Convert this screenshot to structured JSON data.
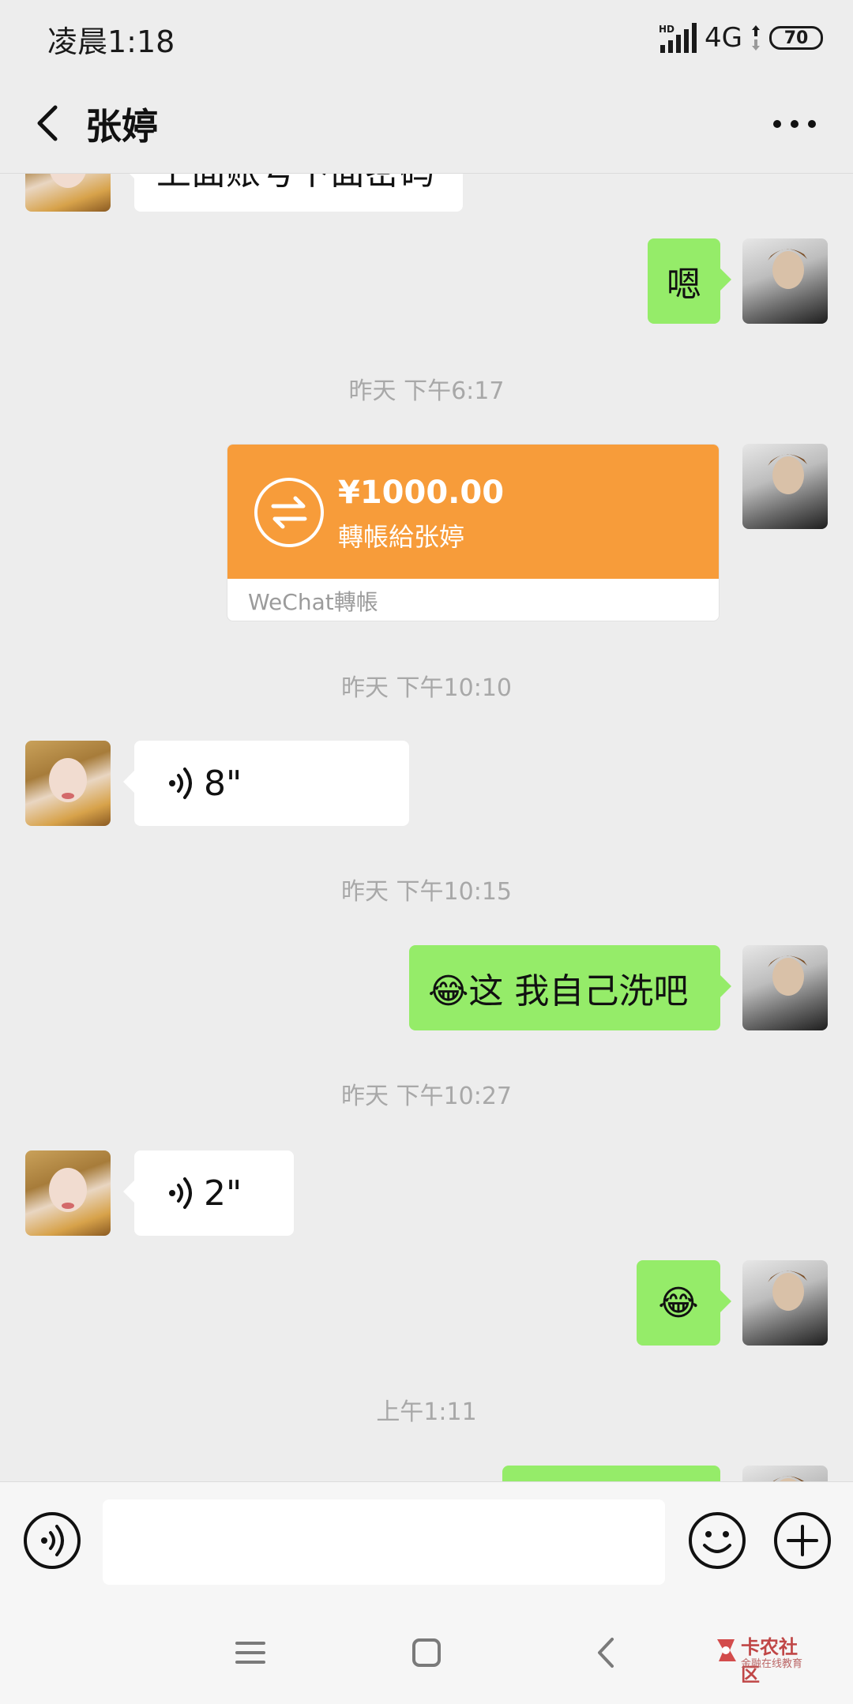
{
  "status_bar": {
    "time": "凌晨1:18",
    "network": "4G",
    "battery": "70"
  },
  "header": {
    "title": "张婷"
  },
  "messages": {
    "partial_top_text": "上面账号下面密码",
    "reply_1": "嗯",
    "ts_1": "昨天 下午6:17",
    "transfer": {
      "amount": "¥1000.00",
      "description": "轉帳給张婷",
      "footer": "WeChat轉帳"
    },
    "ts_2": "昨天 下午10:10",
    "voice_1": "8\"",
    "ts_3": "昨天 下午10:15",
    "reply_2": "😂这 我自己洗吧",
    "ts_4": "昨天 下午10:27",
    "voice_2": "2\"",
    "reply_3": "😂",
    "ts_5": "上午1:11"
  },
  "watermark": {
    "title": "卡农社区",
    "subtitle": "金融在线教育"
  },
  "colors": {
    "bubble_self": "#95ec69",
    "bubble_other": "#ffffff",
    "transfer_orange": "#f79c3a",
    "background": "#ededed"
  }
}
